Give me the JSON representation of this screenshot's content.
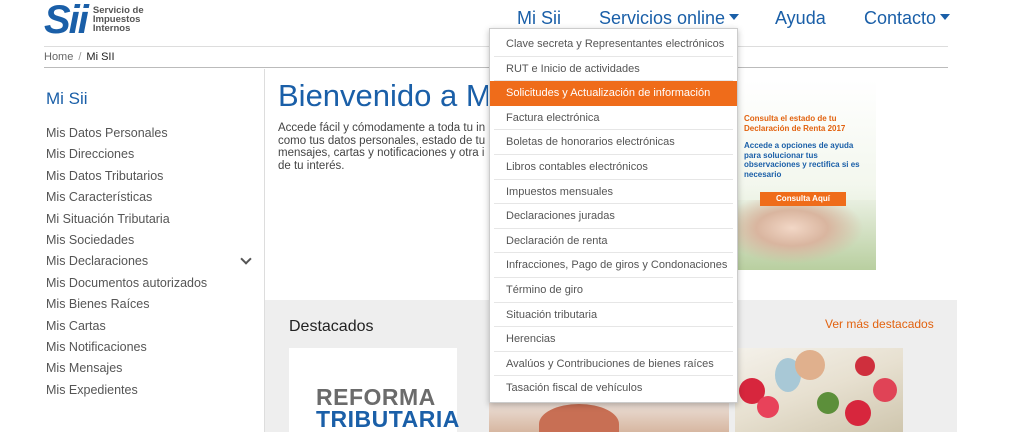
{
  "header": {
    "logo_mark": "Sii",
    "logo_line1": "Servicio de",
    "logo_line2": "Impuestos",
    "logo_line3": "Internos",
    "nav": {
      "mi_sii": "Mi Sii",
      "servicios": "Servicios online",
      "ayuda": "Ayuda",
      "contacto": "Contacto"
    },
    "brand_color": "#1a5fa8",
    "accent_color": "#ef6c1a"
  },
  "breadcrumb": {
    "home": "Home",
    "separator": "/",
    "current": "Mi SII"
  },
  "sidebar": {
    "title": "Mi Sii",
    "items": [
      "Mis Datos Personales",
      "Mis Direcciones",
      "Mis Datos Tributarios",
      "Mis Características",
      "Mi Situación Tributaria",
      "Mis Sociedades",
      "Mis Declaraciones",
      "Mis Documentos autorizados",
      "Mis Bienes Raíces",
      "Mis Cartas",
      "Mis Notificaciones",
      "Mis Mensajes",
      "Mis Expedientes"
    ],
    "expand_icon": "chevron-down-icon"
  },
  "main": {
    "title": "Bienvenido a M",
    "intro": "Accede fácil y cómodamente a toda tu in como tus datos personales, estado de tu mensajes, cartas y notificaciones y otra i de tu interés."
  },
  "promo": {
    "headline": "Consulta el estado de tu Declaración de Renta 2017",
    "body": "Accede a opciones de ayuda para solucionar tus observaciones  y rectifica si es necesario",
    "button": "Consulta Aquí"
  },
  "destacados": {
    "title": "Destacados",
    "more_link": "Ver más destacados",
    "reforma_line1": "REFORMA",
    "reforma_line2": "TRIBUTARIA"
  },
  "dropdown": {
    "items": [
      "Clave secreta y Representantes electrónicos",
      "RUT e Inicio de actividades",
      "Solicitudes y Actualización de información",
      "Factura electrónica",
      "Boletas de honorarios electrónicas",
      "Libros contables electrónicos",
      "Impuestos mensuales",
      "Declaraciones juradas",
      "Declaración de renta",
      "Infracciones, Pago de giros y Condonaciones",
      "Término de giro",
      "Situación tributaria",
      "Herencias",
      "Avalúos y Contribuciones de bienes raíces",
      "Tasación fiscal de vehículos"
    ],
    "active_index": 2
  }
}
